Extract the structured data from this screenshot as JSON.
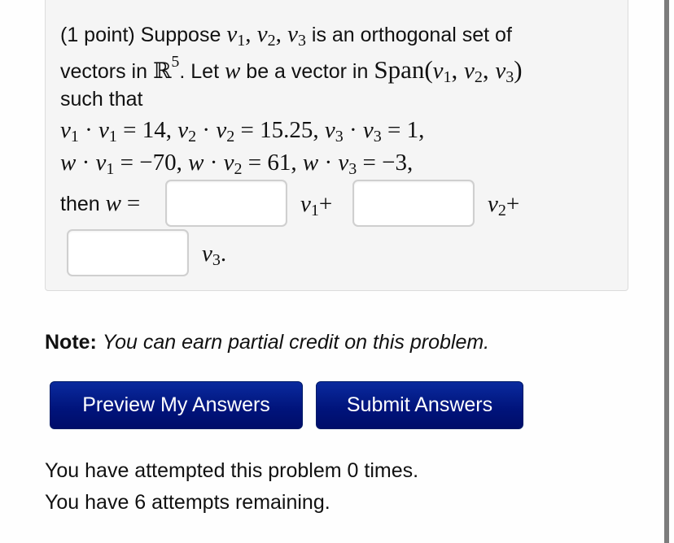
{
  "problem": {
    "points_label": "(1 point) Suppose",
    "vectors_list": [
      "v",
      "1",
      "v",
      "2",
      "v",
      "3"
    ],
    "line1_tail": "is an orthogonal set of",
    "line2_a": "vectors in",
    "space_symbol": "ℝ",
    "space_dim": "5",
    "line2_b": ". Let",
    "w": "w",
    "line2_c": "be a vector in",
    "span_label": "Span(",
    "line3": "such that",
    "dot_products": {
      "v1v1": "14",
      "v2v2": "15.25",
      "v3v3": "1",
      "wv1": "−70",
      "wv2": "61",
      "wv3": "−3"
    },
    "then_label": "then",
    "answer_inputs": [
      {
        "value": "",
        "placeholder": ""
      },
      {
        "value": "",
        "placeholder": ""
      },
      {
        "value": "",
        "placeholder": ""
      }
    ]
  },
  "note": {
    "label": "Note:",
    "text": "You can earn partial credit on this problem."
  },
  "buttons": {
    "preview": "Preview My Answers",
    "submit": "Submit Answers"
  },
  "status": {
    "attempted": "You have attempted this problem 0 times.",
    "remaining": "You have 6 attempts remaining."
  },
  "colors": {
    "button_bg": "#00137a",
    "box_bg": "#f5f5f5"
  }
}
